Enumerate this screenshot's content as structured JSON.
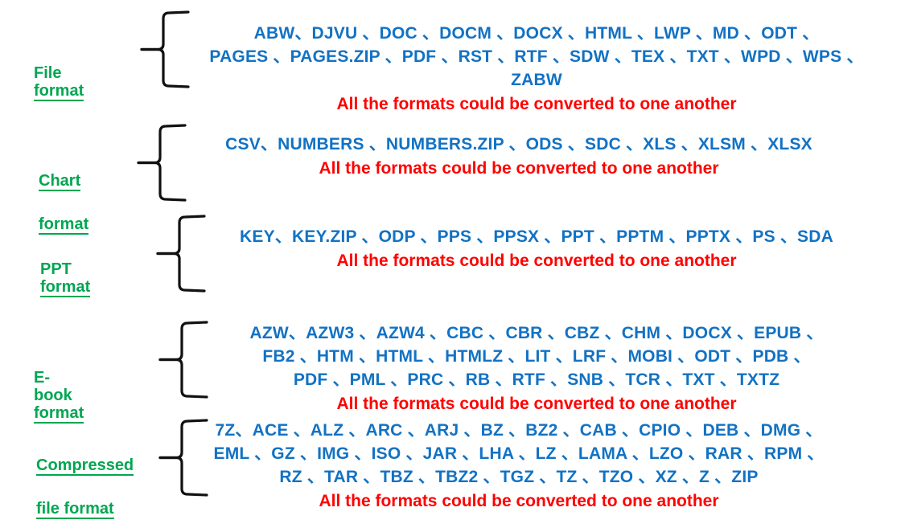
{
  "separator": "、",
  "colors": {
    "label_green": "#00a651",
    "format_blue": "#1272c4",
    "note_red": "#ff0000",
    "brace_black": "#111111",
    "background": "#ffffff"
  },
  "common_note": "All the formats could be converted to one another",
  "groups": [
    {
      "id": "file",
      "label_lines": [
        "File format"
      ],
      "format_lines": [
        "ABW、DJVU 、DOC 、DOCM 、DOCX 、HTML 、LWP 、MD 、ODT 、",
        "PAGES 、PAGES.ZIP 、PDF 、RST 、RTF 、SDW 、TEX 、TXT 、WPD 、WPS 、",
        "ZABW"
      ],
      "formats": [
        "ABW",
        "DJVU",
        "DOC",
        "DOCM",
        "DOCX",
        "HTML",
        "LWP",
        "MD",
        "ODT",
        "PAGES",
        "PAGES.ZIP",
        "PDF",
        "RST",
        "RTF",
        "SDW",
        "TEX",
        "TXT",
        "WPD",
        "WPS",
        "ZABW"
      ],
      "note": "All the formats could be converted to one another"
    },
    {
      "id": "chart",
      "label_lines": [
        "Chart",
        "format"
      ],
      "format_lines": [
        "CSV、NUMBERS 、NUMBERS.ZIP 、ODS 、SDC 、XLS 、XLSM 、XLSX"
      ],
      "formats": [
        "CSV",
        "NUMBERS",
        "NUMBERS.ZIP",
        "ODS",
        "SDC",
        "XLS",
        "XLSM",
        "XLSX"
      ],
      "note": "All the formats could be converted to one another"
    },
    {
      "id": "ppt",
      "label_lines": [
        "PPT format"
      ],
      "format_lines": [
        "KEY、KEY.ZIP 、ODP 、PPS 、PPSX 、PPT 、PPTM 、PPTX 、PS 、SDA"
      ],
      "formats": [
        "KEY",
        "KEY.ZIP",
        "ODP",
        "PPS",
        "PPSX",
        "PPT",
        "PPTM",
        "PPTX",
        "PS",
        "SDA"
      ],
      "note": "All the formats could be converted to one another"
    },
    {
      "id": "ebook",
      "label_lines": [
        "E-book format"
      ],
      "format_lines": [
        "AZW、AZW3 、AZW4 、CBC 、CBR 、CBZ 、CHM 、DOCX 、EPUB 、",
        "FB2 、HTM 、HTML 、HTMLZ 、LIT 、LRF 、MOBI 、ODT 、PDB 、",
        "PDF 、PML 、PRC 、RB 、RTF 、SNB 、TCR 、TXT 、TXTZ"
      ],
      "formats": [
        "AZW",
        "AZW3",
        "AZW4",
        "CBC",
        "CBR",
        "CBZ",
        "CHM",
        "DOCX",
        "EPUB",
        "FB2",
        "HTM",
        "HTML",
        "HTMLZ",
        "LIT",
        "LRF",
        "MOBI",
        "ODT",
        "PDB",
        "PDF",
        "PML",
        "PRC",
        "RB",
        "RTF",
        "SNB",
        "TCR",
        "TXT",
        "TXTZ"
      ],
      "note": "All the formats could be converted to one another"
    },
    {
      "id": "compressed",
      "label_lines": [
        "Compressed",
        "file format"
      ],
      "format_lines": [
        "7Z、ACE 、ALZ 、ARC 、ARJ 、BZ 、BZ2 、CAB 、CPIO 、DEB 、DMG 、",
        "EML 、GZ 、IMG 、ISO 、JAR 、LHA 、LZ 、LAMA 、LZO 、RAR 、RPM 、",
        "RZ 、TAR 、TBZ 、TBZ2 、TGZ 、TZ 、TZO 、XZ 、Z 、ZIP"
      ],
      "formats": [
        "7Z",
        "ACE",
        "ALZ",
        "ARC",
        "ARJ",
        "BZ",
        "BZ2",
        "CAB",
        "CPIO",
        "DEB",
        "DMG",
        "EML",
        "GZ",
        "IMG",
        "ISO",
        "JAR",
        "LHA",
        "LZ",
        "LAMA",
        "LZO",
        "RAR",
        "RPM",
        "RZ",
        "TAR",
        "TBZ",
        "TBZ2",
        "TGZ",
        "TZ",
        "TZO",
        "XZ",
        "Z",
        "ZIP"
      ],
      "note": "All the formats could be converted to one another"
    }
  ]
}
